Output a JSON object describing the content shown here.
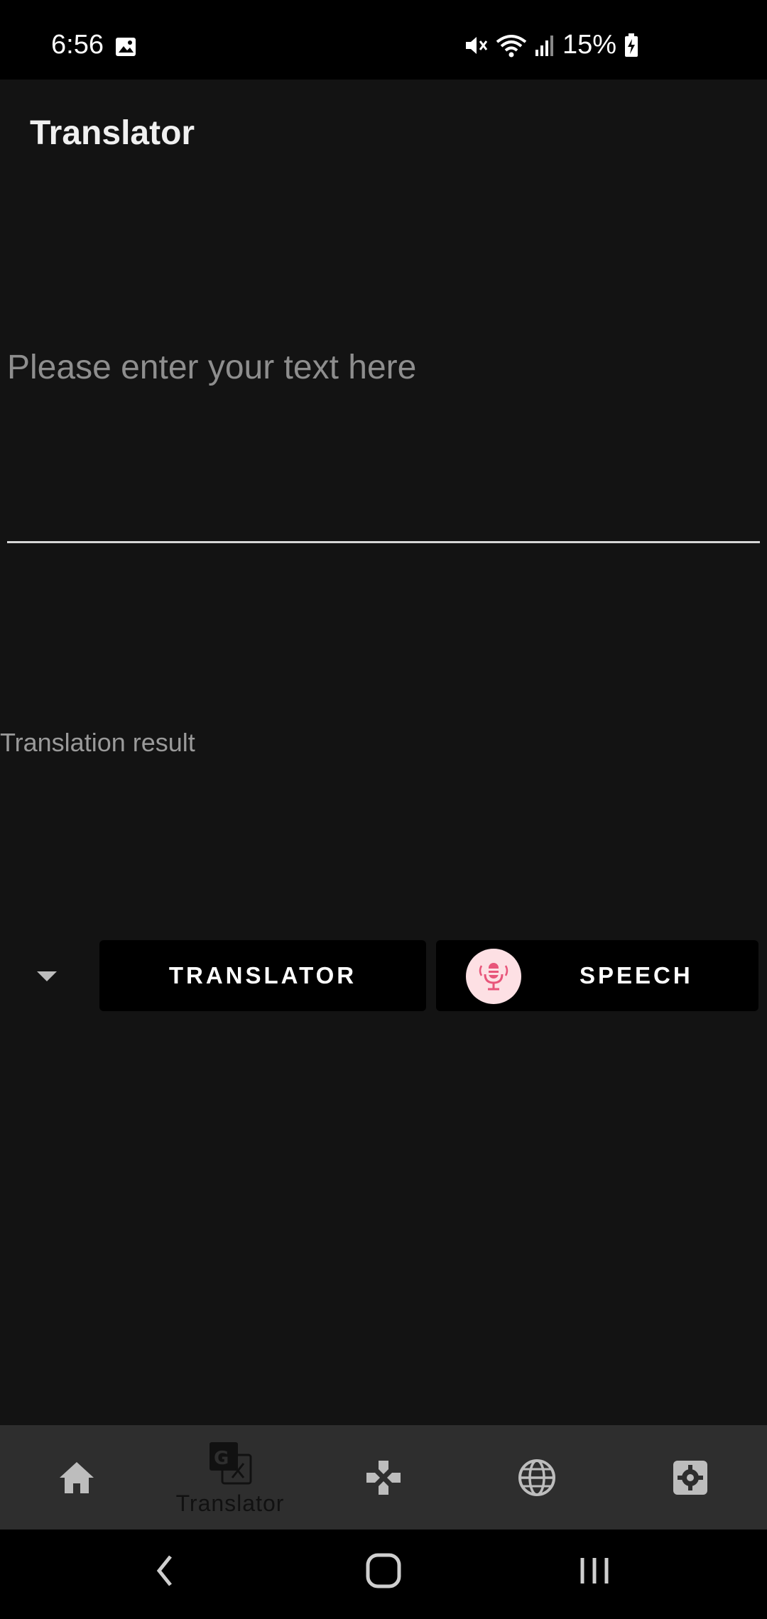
{
  "status": {
    "time": "6:56",
    "battery": "15%",
    "icons": [
      "image-icon",
      "mute-icon",
      "wifi-icon",
      "signal-icon",
      "battery-charging-icon"
    ]
  },
  "app": {
    "title": "Translator"
  },
  "input": {
    "placeholder": "Please enter your text here",
    "value": ""
  },
  "result": {
    "label": "Translation result"
  },
  "actions": {
    "translator_label": "TRANSLATOR",
    "speech_label": "SPEECH"
  },
  "colors": {
    "background": "#131313",
    "button": "#000000",
    "nav_bar": "#2e2e2e",
    "mic_badge": "#fde0e4",
    "mic_accent": "#e8557a"
  },
  "bottom_nav": {
    "items": [
      {
        "icon": "home-icon",
        "label": ""
      },
      {
        "icon": "translate-icon",
        "label": "Translator"
      },
      {
        "icon": "gamepad-icon",
        "label": ""
      },
      {
        "icon": "globe-icon",
        "label": ""
      },
      {
        "icon": "settings-icon",
        "label": ""
      }
    ],
    "active_index": 1
  },
  "system_nav": [
    "back-icon",
    "home-circle-icon",
    "recents-icon"
  ]
}
